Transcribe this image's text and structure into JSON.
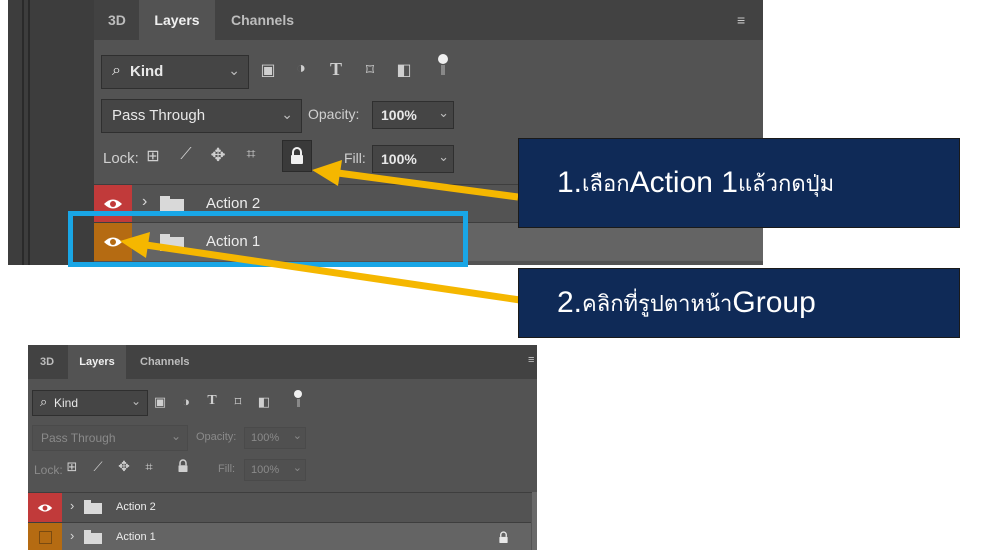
{
  "top_panel": {
    "tabs": [
      {
        "label": "3D"
      },
      {
        "label": "Layers"
      },
      {
        "label": "Channels"
      }
    ],
    "filter_kind": "Kind",
    "blend_mode": "Pass Through",
    "opacity_label": "Opacity:",
    "opacity_value": "100%",
    "lock_label": "Lock:",
    "fill_label": "Fill:",
    "fill_value": "100%",
    "layers": [
      {
        "name": "Action 2",
        "eye_color": "#c13a3a"
      },
      {
        "name": "Action 1",
        "eye_color": "#b56b12"
      }
    ]
  },
  "bottom_panel": {
    "tabs": [
      {
        "label": "3D"
      },
      {
        "label": "Layers"
      },
      {
        "label": "Channels"
      }
    ],
    "filter_kind": "Kind",
    "blend_mode": "Pass Through",
    "opacity_label": "Opacity:",
    "opacity_value": "100%",
    "lock_label": "Lock:",
    "fill_label": "Fill:",
    "fill_value": "100%",
    "layers": [
      {
        "name": "Action 2",
        "eye_color": "#c13a3a"
      },
      {
        "name": "Action 1",
        "eye_color": "#b56b12"
      }
    ]
  },
  "callouts": {
    "step1": {
      "num": "1.",
      "text": "เลือก ",
      "big": "Action 1",
      "rest": " แล้วกดปุ่ม"
    },
    "step2": {
      "num": "2.",
      "text": "คลิกที่รูปตาหน้า ",
      "big": "Group"
    }
  },
  "colors": {
    "highlight_box": "#19a6e6",
    "arrow": "#f5b700",
    "callout_bg": "#0f2a57"
  },
  "icons": [
    "search-icon",
    "image-filter-icon",
    "adjustment-filter-icon",
    "type-filter-icon",
    "shape-filter-icon",
    "smart-object-filter-icon",
    "filter-toggle-icon",
    "lock-pixels-icon",
    "lock-paint-icon",
    "lock-move-icon",
    "lock-artboard-icon",
    "lock-all-icon",
    "eye-icon",
    "folder-icon",
    "panel-menu-icon"
  ]
}
